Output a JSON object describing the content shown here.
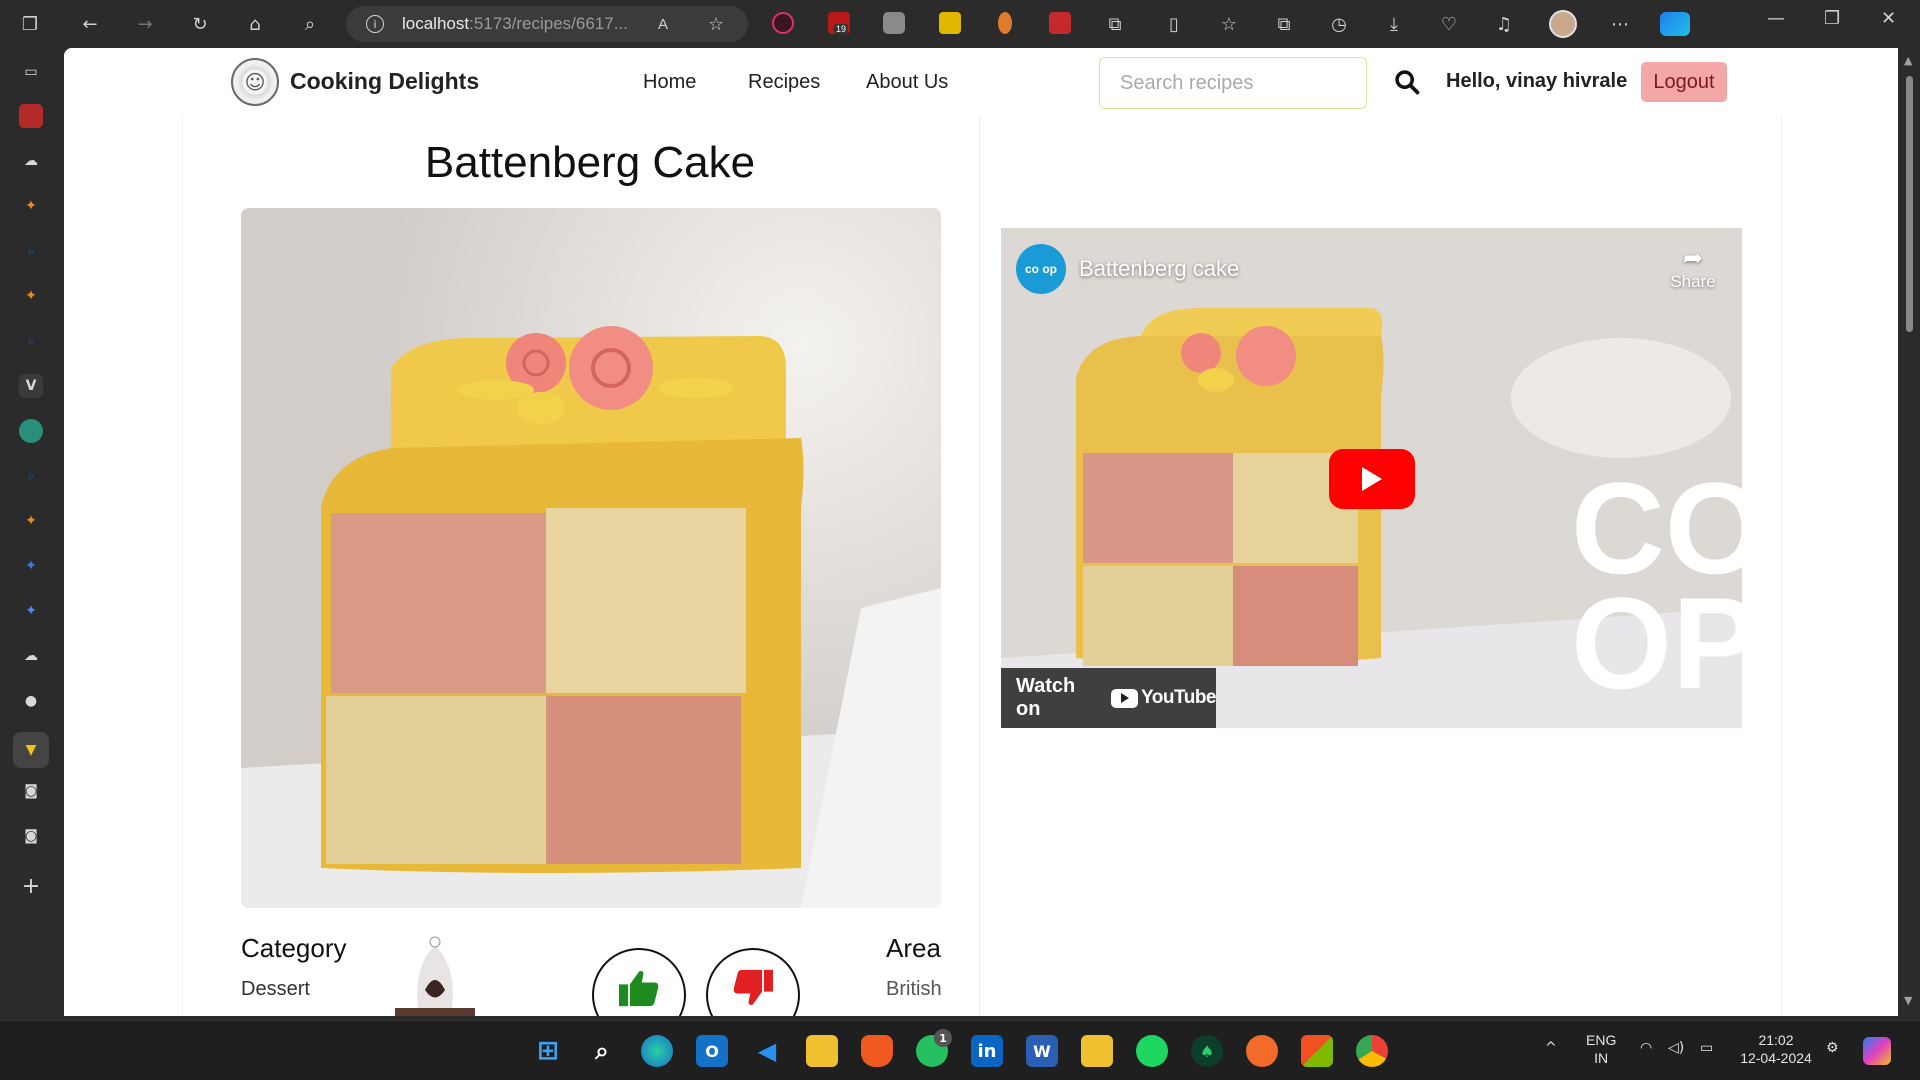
{
  "browser": {
    "url_host": "localhost",
    "url_path": ":5173/recipes/6617...",
    "ext_badge": "19",
    "read_aloud": "A"
  },
  "site": {
    "brand": "Cooking Delights",
    "nav": [
      "Home",
      "Recipes",
      "About Us"
    ],
    "search_placeholder": "Search recipes",
    "greeting": "Hello, vinay hivrale",
    "logout_label": "Logout"
  },
  "recipe": {
    "title": "Battenberg Cake",
    "category_label": "Category",
    "category_value": "Dessert",
    "area_label": "Area",
    "area_value": "British"
  },
  "video": {
    "channel": "co op",
    "title": "Battenberg cake",
    "share_label": "Share",
    "watch_on": "Watch on",
    "youtube": "YouTube"
  },
  "taskbar": {
    "lang_top": "ENG",
    "lang_bottom": "IN",
    "time": "21:02",
    "date": "12-04-2024",
    "whatsapp_badge": "1"
  },
  "colors": {
    "logout_bg": "#f4a7a7",
    "search_border": "#d6e79d",
    "thumbs_up": "#1f8b1f",
    "thumbs_down": "#e02020",
    "play_red": "#ff0000"
  }
}
